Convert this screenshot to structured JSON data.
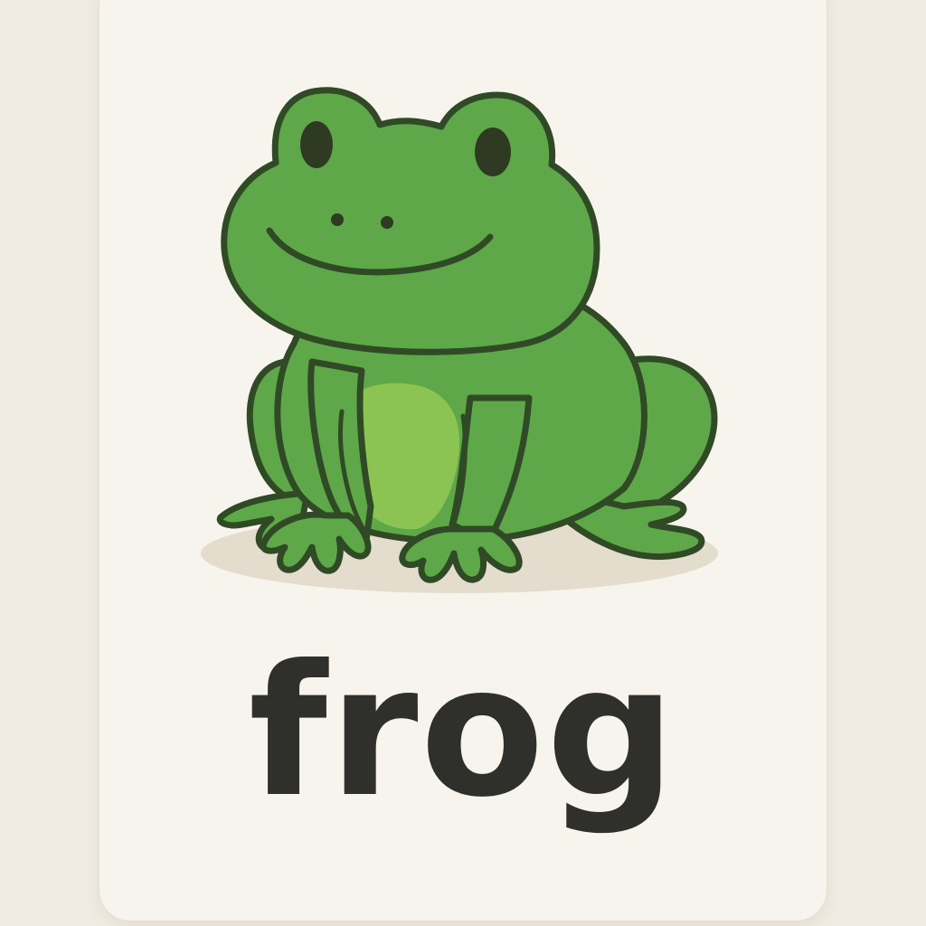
{
  "card": {
    "word": "frog",
    "illustration_icon": "frog-icon"
  },
  "colors": {
    "page_background": "#f1ece3",
    "card_background": "#f7f4ee",
    "frog_body": "#5fa84a",
    "frog_belly": "#8cc454",
    "frog_outline": "#2f4a25",
    "shadow": "#e4dccd",
    "text": "#2f2f2c"
  }
}
